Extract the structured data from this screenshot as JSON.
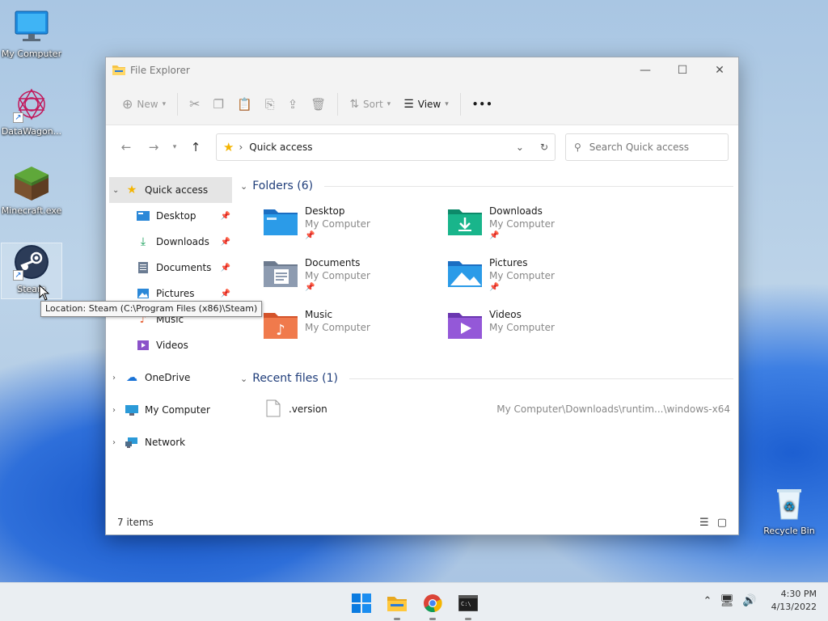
{
  "desktop": {
    "icons": [
      {
        "label": "My Computer",
        "icon": "monitor-icon"
      },
      {
        "label": "DataWagon...",
        "icon": "datawagon-icon"
      },
      {
        "label": "Minecraft.exe",
        "icon": "minecraft-icon"
      },
      {
        "label": "Steam",
        "icon": "steam-icon"
      },
      {
        "label": "Recycle Bin",
        "icon": "recycle-bin-icon"
      }
    ],
    "tooltip": "Location: Steam (C:\\Program Files (x86)\\Steam)"
  },
  "window": {
    "title": "File Explorer",
    "controls": {
      "minimize": "—",
      "maximize": "☐",
      "close": "✕"
    },
    "toolbar": {
      "new_label": "New",
      "sort_label": "Sort",
      "view_label": "View",
      "more_label": "•••"
    },
    "address": {
      "location": "Quick access"
    },
    "search": {
      "placeholder": "Search Quick access"
    },
    "sidebar": {
      "quick_access": "Quick access",
      "pinned": [
        {
          "label": "Desktop"
        },
        {
          "label": "Downloads"
        },
        {
          "label": "Documents"
        },
        {
          "label": "Pictures"
        },
        {
          "label": "Music"
        },
        {
          "label": "Videos"
        }
      ],
      "roots": [
        {
          "label": "OneDrive"
        },
        {
          "label": "My Computer"
        },
        {
          "label": "Network"
        }
      ]
    },
    "folders_heading": "Folders (6)",
    "folders": [
      {
        "name": "Desktop",
        "location": "My Computer",
        "pinned": true
      },
      {
        "name": "Downloads",
        "location": "My Computer",
        "pinned": true
      },
      {
        "name": "Documents",
        "location": "My Computer",
        "pinned": true
      },
      {
        "name": "Pictures",
        "location": "My Computer",
        "pinned": true
      },
      {
        "name": "Music",
        "location": "My Computer",
        "pinned": false
      },
      {
        "name": "Videos",
        "location": "My Computer",
        "pinned": false
      }
    ],
    "recent_heading": "Recent files (1)",
    "recent_files": [
      {
        "name": ".version",
        "path": "My Computer\\Downloads\\runtim...\\windows-x64"
      }
    ],
    "status": {
      "items": "7 items"
    }
  },
  "taskbar": {
    "apps": [
      "windows-start-icon",
      "file-explorer-icon",
      "chrome-icon",
      "terminal-icon"
    ],
    "clock": {
      "time": "4:30 PM",
      "date": "4/13/2022"
    }
  },
  "colors": {
    "accent": "#0067c0",
    "folder_yellow": "#f6c344",
    "selection": "#e5e5e5"
  }
}
